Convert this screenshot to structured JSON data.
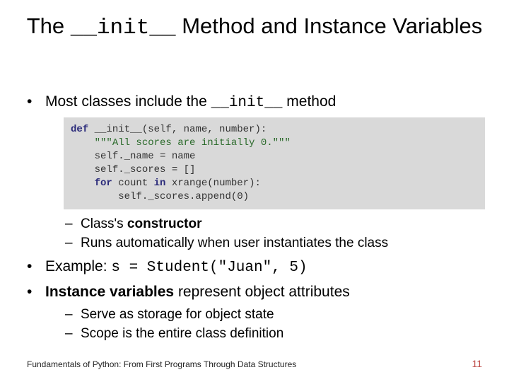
{
  "title": {
    "pre": "The ",
    "code": "__init__",
    "post": " Method and Instance Variables"
  },
  "bullets": {
    "b1_pre": "Most classes include the ",
    "b1_code": "__init__",
    "b1_post": " method",
    "code_line1_kw": "def",
    "code_line1_rest": " __init__(self, name, number):",
    "code_line2_str": "\"\"\"All scores are initially 0.\"\"\"",
    "code_line3": "self._name = name",
    "code_line4": "self._scores = []",
    "code_line5_kw": "for",
    "code_line5_mid": " count ",
    "code_line5_kw2": "in",
    "code_line5_rest": " xrange(number):",
    "code_line6": "self._scores.append(0)",
    "sub1_pre": "Class's ",
    "sub1_bold": "constructor",
    "sub2": "Runs automatically when user instantiates the class",
    "b2_pre": "Example: ",
    "b2_code": "s = Student(\"Juan\", 5)",
    "b3_bold": "Instance variables",
    "b3_post": " represent object attributes",
    "sub3": "Serve as storage for object state",
    "sub4": "Scope is the entire class definition"
  },
  "footer": "Fundamentals of Python: From First Programs Through Data Structures",
  "page": "11"
}
